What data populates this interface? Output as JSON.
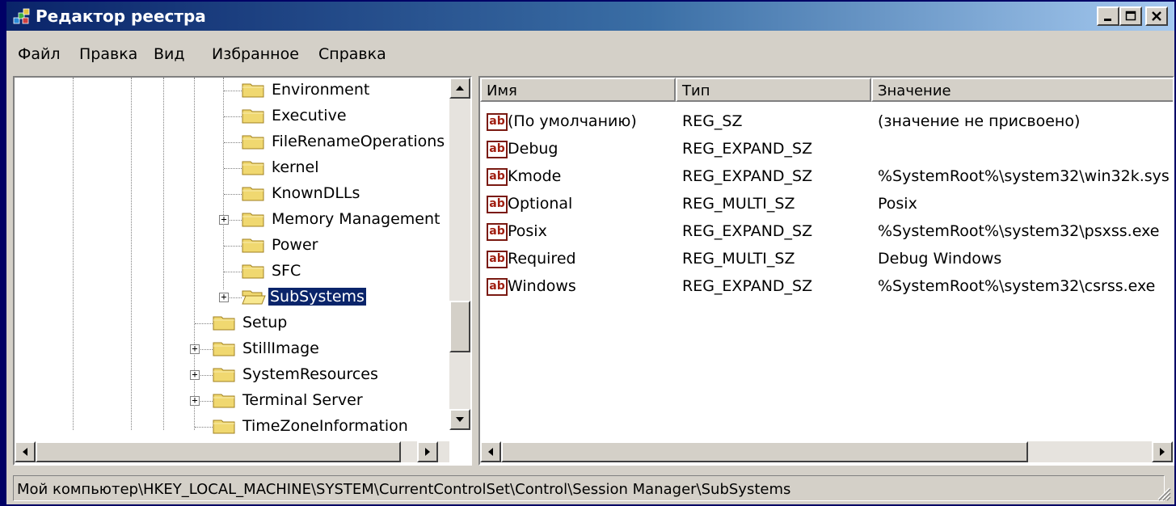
{
  "window": {
    "title": "Редактор реестра",
    "minimize_icon": "minimize-icon",
    "maximize_icon": "maximize-icon",
    "close_icon": "close-icon"
  },
  "menu": [
    "Файл",
    "Правка",
    "Вид",
    "Избранное",
    "Справка"
  ],
  "tree": {
    "nodes": [
      {
        "label": "Environment",
        "expandable": false
      },
      {
        "label": "Executive",
        "expandable": false
      },
      {
        "label": "FileRenameOperations",
        "expandable": false
      },
      {
        "label": "kernel",
        "expandable": false
      },
      {
        "label": "KnownDLLs",
        "expandable": false
      },
      {
        "label": "Memory Management",
        "expandable": true
      },
      {
        "label": "Power",
        "expandable": false
      },
      {
        "label": "SFC",
        "expandable": false
      },
      {
        "label": "SubSystems",
        "expandable": true,
        "selected": true
      },
      {
        "label": "Setup",
        "expandable": false
      },
      {
        "label": "StillImage",
        "expandable": true
      },
      {
        "label": "SystemResources",
        "expandable": true
      },
      {
        "label": "Terminal Server",
        "expandable": true
      },
      {
        "label": "TimeZoneInformation",
        "expandable": false
      }
    ]
  },
  "list": {
    "columns": [
      "Имя",
      "Тип",
      "Значение"
    ],
    "rows": [
      {
        "name": "(По умолчанию)",
        "type": "REG_SZ",
        "value": "(значение не присвоено)"
      },
      {
        "name": "Debug",
        "type": "REG_EXPAND_SZ",
        "value": ""
      },
      {
        "name": "Kmode",
        "type": "REG_EXPAND_SZ",
        "value": "%SystemRoot%\\system32\\win32k.sys"
      },
      {
        "name": "Optional",
        "type": "REG_MULTI_SZ",
        "value": "Posix"
      },
      {
        "name": "Posix",
        "type": "REG_EXPAND_SZ",
        "value": "%SystemRoot%\\system32\\psxss.exe"
      },
      {
        "name": "Required",
        "type": "REG_MULTI_SZ",
        "value": "Debug Windows"
      },
      {
        "name": "Windows",
        "type": "REG_EXPAND_SZ",
        "value": "%SystemRoot%\\system32\\csrss.exe"
      }
    ]
  },
  "status": {
    "path": "Мой компьютер\\HKEY_LOCAL_MACHINE\\SYSTEM\\CurrentControlSet\\Control\\Session Manager\\SubSystems"
  },
  "colors": {
    "title_start": "#0a246a",
    "title_end": "#a6caf0",
    "selection": "#0a246a",
    "chrome": "#d4d0c8",
    "desktop": "#000066"
  }
}
